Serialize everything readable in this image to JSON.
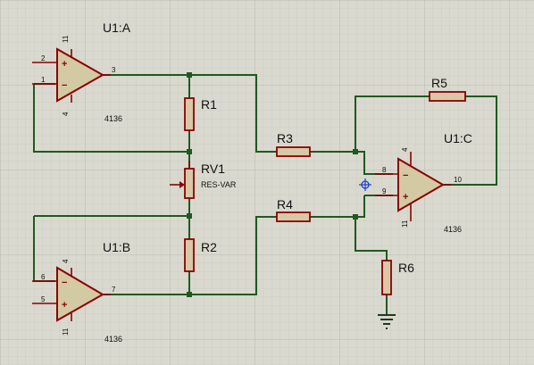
{
  "opamps": {
    "a": {
      "ref": "U1:A",
      "part": "4136",
      "pin_pos": "2",
      "pin_neg": "1",
      "pin_out": "3",
      "pin_vp": "11",
      "pin_vn": "4"
    },
    "b": {
      "ref": "U1:B",
      "part": "4136",
      "pin_neg": "6",
      "pin_pos": "5",
      "pin_out": "7",
      "pin_vp": "4",
      "pin_vn": "11"
    },
    "c": {
      "ref": "U1:C",
      "part": "4136",
      "pin_neg": "8",
      "pin_pos": "9",
      "pin_out": "10",
      "pin_vp": "4",
      "pin_vn": "11"
    }
  },
  "resistors": {
    "r1": "R1",
    "r2": "R2",
    "r3": "R3",
    "r4": "R4",
    "r5": "R5",
    "r6": "R6"
  },
  "pot": {
    "ref": "RV1",
    "part": "RES-VAR"
  },
  "symbols": {
    "plus": "+",
    "minus": "−"
  },
  "colors": {
    "wire": "#1e5a1e",
    "component": "#8b0000",
    "background": "#d9d9cf",
    "cursor": "#1a3fd0"
  }
}
